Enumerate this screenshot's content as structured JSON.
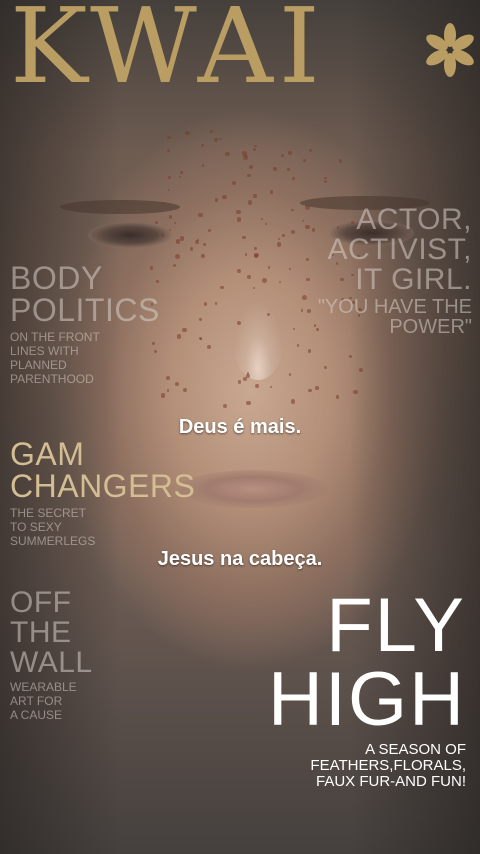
{
  "magazine": {
    "logo": "KWAI*",
    "right_cover_line": [
      "ACTOR,",
      "ACTIVIST,",
      "IT GIRL.",
      "\"YOU HAVE THE",
      "POWER\""
    ],
    "body_politics": {
      "title": [
        "BODY",
        "POLITICS"
      ],
      "subtitle": [
        "ON THE FRONT",
        "LINES WITH",
        "PLANNED",
        "PARENTHOOD"
      ]
    },
    "gam_changers": {
      "title": [
        "GAM",
        "CHANGERS"
      ],
      "subtitle": [
        "THE SECRET",
        "TO SEXY",
        "SUMMERLEGS"
      ]
    },
    "off_the_wall": {
      "title": [
        "OFF",
        "THE",
        "WALL"
      ],
      "subtitle": [
        "WEARABLE",
        "ART FOR",
        "A CAUSE"
      ]
    },
    "fly_high": {
      "title": [
        "FLY",
        "HIGH"
      ],
      "subtitle": [
        "A SEASON OF",
        "FEATHERS,FLORALS,",
        "FAUX FUR-AND FUN!"
      ]
    }
  },
  "captions": {
    "line1": "Deus  é  mais.",
    "line2": "Jesus na cabeça."
  },
  "colors": {
    "logo_gold": "#b99d62",
    "headline_gold": "#d3bd93",
    "caption_white": "#ffffff"
  }
}
